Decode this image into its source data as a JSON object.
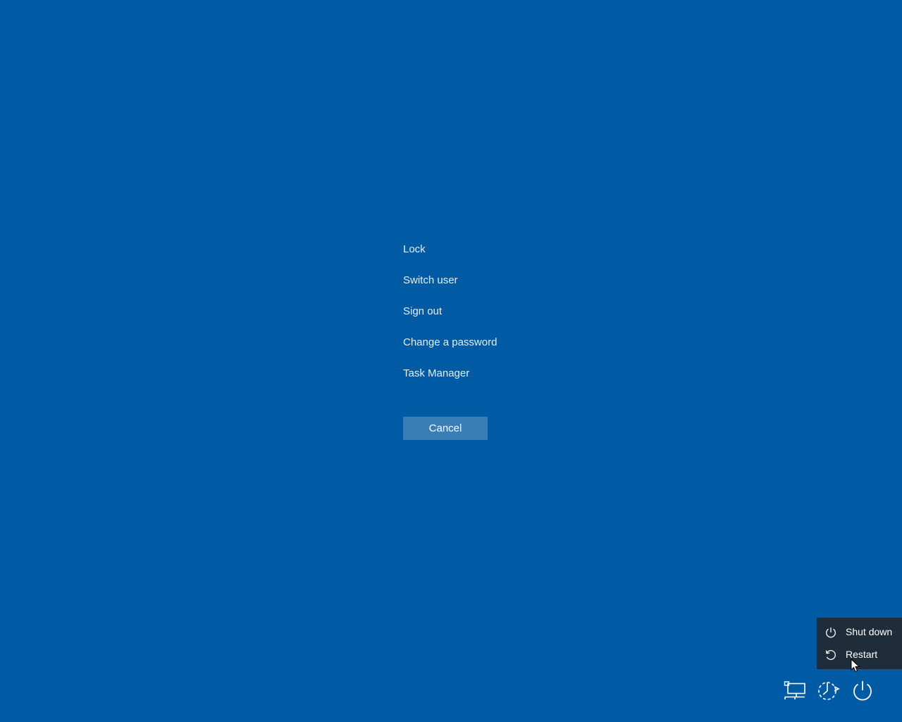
{
  "options": {
    "lock": "Lock",
    "switch_user": "Switch user",
    "sign_out": "Sign out",
    "change_password": "Change a password",
    "task_manager": "Task Manager"
  },
  "cancel_label": "Cancel",
  "power_menu": {
    "shut_down": "Shut down",
    "restart": "Restart"
  },
  "icons": {
    "network": "network-icon",
    "accessibility": "ease-of-access-icon",
    "power": "power-icon"
  },
  "colors": {
    "background": "#005ba4",
    "button": "#3a7eb8",
    "menu_background": "#1f2c3a",
    "text": "#ffffff"
  }
}
